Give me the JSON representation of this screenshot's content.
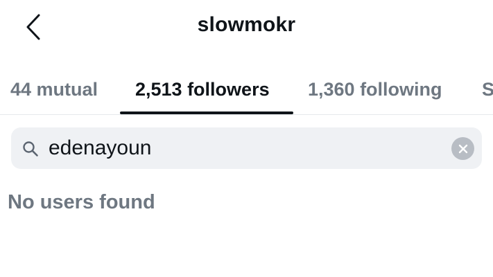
{
  "header": {
    "title": "slowmokr",
    "back_icon": "chevron-left-icon"
  },
  "tabs": [
    {
      "label": "44 mutual",
      "active": false
    },
    {
      "label": "2,513 followers",
      "active": true
    },
    {
      "label": "1,360 following",
      "active": false
    },
    {
      "label": "S",
      "active": false
    }
  ],
  "search": {
    "value": "edenayoun",
    "icon": "search-icon",
    "clear_icon": "clear-icon"
  },
  "results": {
    "empty_message": "No users found"
  },
  "colors": {
    "text_primary": "#0f1419",
    "text_secondary": "#6e7781",
    "search_bg": "#eff1f4",
    "clear_bg": "#b8bdc4"
  }
}
